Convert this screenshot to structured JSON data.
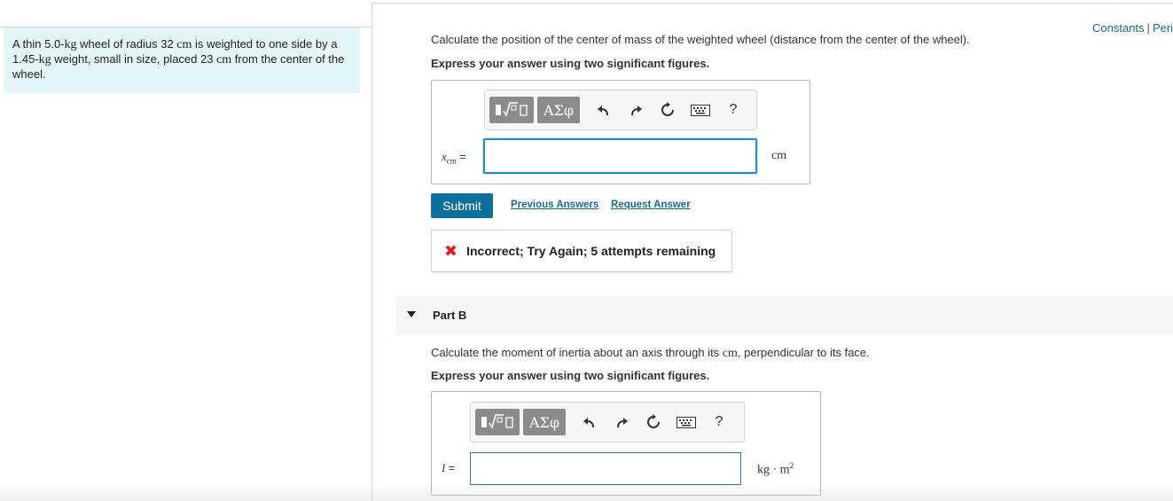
{
  "header": {
    "constants_link": "Constants",
    "separator": "|",
    "periodic_link": "Periodic Table"
  },
  "problem": {
    "text_1": "A thin 5.0-",
    "unit_kg_1": "kg",
    "text_2": " wheel of radius 32 ",
    "unit_cm_1": "cm",
    "text_3": " is weighted to one side by a 1.45-",
    "unit_kg_2": "kg",
    "text_4": " weight, small in size, placed 23 ",
    "unit_cm_2": "cm",
    "text_5": " from the center of the wheel."
  },
  "part_a": {
    "question": "Calculate the position of the center of mass of the weighted wheel (distance from the center of the wheel).",
    "instruction": "Express your answer using two significant figures.",
    "var_symbol": "x",
    "var_sub": "cm",
    "equals": "=",
    "unit": "cm",
    "input_value": "",
    "submit_label": "Submit",
    "previous_answers": "Previous Answers",
    "request_answer": "Request Answer",
    "feedback": "Incorrect; Try Again; 5 attempts remaining"
  },
  "part_b": {
    "label": "Part B",
    "question_1": "Calculate the moment of inertia about an axis through its ",
    "question_cm": "cm",
    "question_2": ", perpendicular to its face.",
    "instruction": "Express your answer using two significant figures.",
    "var_symbol": "I",
    "equals": "=",
    "unit": "kg · m",
    "unit_exp": "2",
    "input_value": ""
  },
  "toolbar": {
    "greek_label": "ΑΣφ",
    "help_label": "?",
    "icons": [
      "templates-icon",
      "greek-icon",
      "undo-icon",
      "redo-icon",
      "reset-icon",
      "keyboard-icon",
      "help-icon"
    ]
  },
  "colors": {
    "accent": "#0e6f9c",
    "link": "#1a6a96",
    "problem_bg": "#e3f5f7",
    "error": "#e0201f"
  }
}
